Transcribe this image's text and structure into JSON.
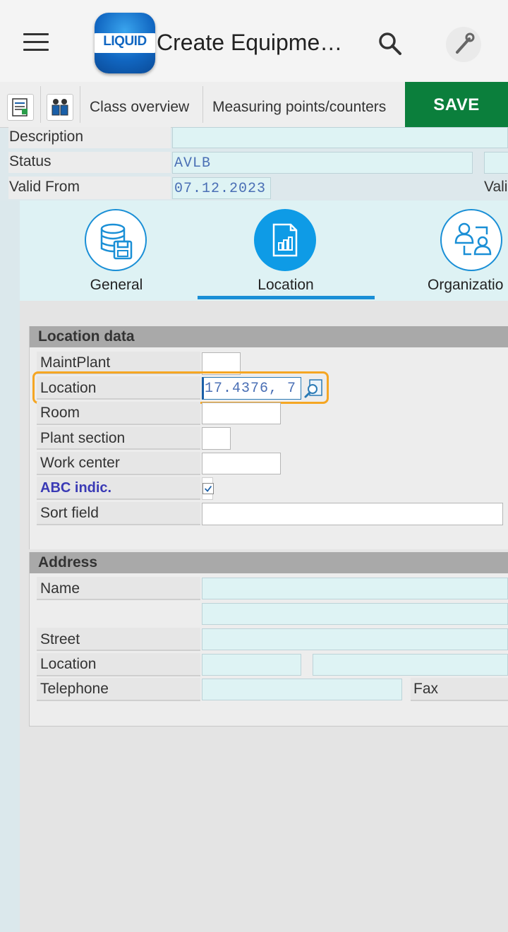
{
  "app": {
    "logo_text": "LIQUID",
    "title": "Create Equipme…"
  },
  "toolbar": {
    "class_overview": "Class overview",
    "measuring_points": "Measuring points/counters",
    "save": "SAVE"
  },
  "header_form": {
    "description_label": "Description",
    "description_value": "",
    "status_label": "Status",
    "status_value": "AVLB",
    "valid_from_label": "Valid From",
    "valid_from_value": "07.12.2023",
    "valid_to_label_partial": "Vali"
  },
  "tabs": [
    {
      "label": "General",
      "icon": "database-save-icon",
      "active": false
    },
    {
      "label": "Location",
      "icon": "chart-document-icon",
      "active": true
    },
    {
      "label": "Organizatio",
      "icon": "organization-icon",
      "active": false
    }
  ],
  "location_data": {
    "heading": "Location data",
    "maintplant_label": "MaintPlant",
    "maintplant_value": "",
    "location_label": "Location",
    "location_value": "17.4376, 7",
    "room_label": "Room",
    "plant_section_label": "Plant section",
    "work_center_label": "Work center",
    "abc_label": "ABC indic.",
    "abc_checked": true,
    "sort_field_label": "Sort field"
  },
  "address": {
    "heading": "Address",
    "name_label": "Name",
    "street_label": "Street",
    "location_label": "Location",
    "telephone_label": "Telephone",
    "fax_label": "Fax"
  },
  "colors": {
    "save_green": "#0b7f3c",
    "accent_blue": "#1a8fd6",
    "highlight_orange": "#f5a623",
    "field_cyan": "#def3f4"
  }
}
